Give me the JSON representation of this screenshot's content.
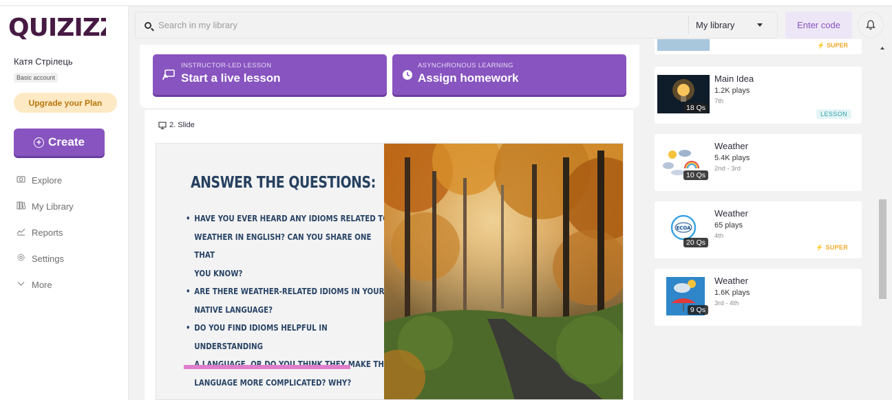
{
  "app": {
    "logo_text": "Quizizz",
    "brand_color": "#8854c0"
  },
  "sidebar": {
    "user_name": "Катя Стрілець",
    "account_type": "Basic account",
    "upgrade_label": "Upgrade your Plan",
    "create_label": "Create",
    "items": [
      {
        "label": "Explore",
        "icon": "explore-icon"
      },
      {
        "label": "My Library",
        "icon": "library-icon"
      },
      {
        "label": "Reports",
        "icon": "reports-icon"
      },
      {
        "label": "Settings",
        "icon": "gear-icon"
      },
      {
        "label": "More",
        "icon": "chevron-down-icon"
      }
    ]
  },
  "header": {
    "search_placeholder": "Search in my library",
    "library_select": "My library",
    "enter_code_label": "Enter code"
  },
  "actions": {
    "live": {
      "small": "INSTRUCTOR-LED LESSON",
      "big": "Start a live lesson"
    },
    "homework": {
      "small": "ASYNCHRONOUS LEARNING",
      "big": "Assign homework"
    }
  },
  "slide": {
    "label": "2. Slide",
    "title": "ANSWER THE QUESTIONS:",
    "bullet_lines": [
      "HAVE YOU EVER HEARD ANY IDIOMS RELATED TO",
      "WEATHER IN ENGLISH? CAN YOU SHARE ONE THAT",
      "YOU KNOW?",
      "ARE THERE WEATHER-RELATED IDIOMS IN YOUR",
      "NATIVE LANGUAGE?",
      "DO YOU FIND IDIOMS HELPFUL IN UNDERSTANDING",
      "A LANGUAGE, OR DO YOU THINK THEY MAKE THE",
      "LANGUAGE MORE COMPLICATED? WHY?"
    ]
  },
  "right_panel": {
    "partial_tag": "SUPER",
    "cards": [
      {
        "title": "Main Idea",
        "plays": "1.2K plays",
        "grade": "7th",
        "qs": "18 Qs",
        "tag": "LESSON"
      },
      {
        "title": "Weather",
        "plays": "5.4K plays",
        "grade": "2nd - 3rd",
        "qs": "10 Qs",
        "tag": ""
      },
      {
        "title": "Weather",
        "plays": "65 plays",
        "grade": "4th",
        "qs": "20 Qs",
        "tag": "SUPER"
      },
      {
        "title": "Weather",
        "plays": "1.6K plays",
        "grade": "3rd - 4th",
        "qs": "9 Qs",
        "tag": ""
      }
    ]
  }
}
